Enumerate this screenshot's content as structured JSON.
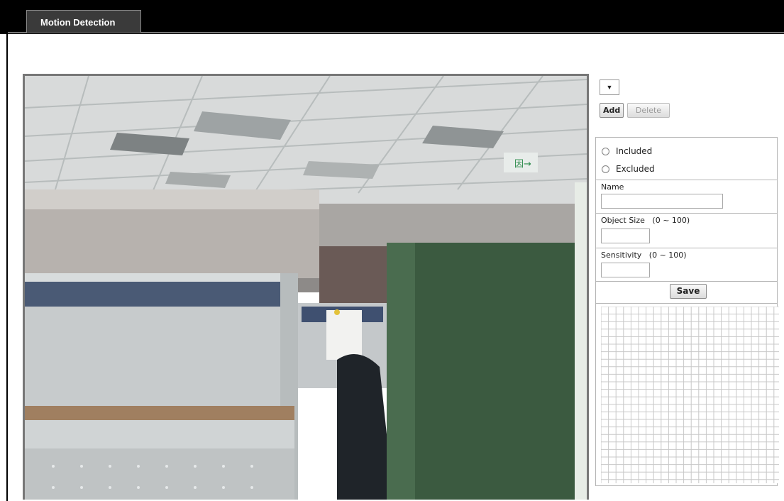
{
  "tabs": [
    {
      "label": "Motion Detection",
      "active": true
    }
  ],
  "camera": {
    "icon": "camera-feed-image"
  },
  "region_selector": {
    "value": "",
    "icon": "chevron-down-icon"
  },
  "buttons": {
    "add_label": "Add",
    "delete_label": "Delete",
    "delete_enabled": false,
    "save_label": "Save"
  },
  "mode": {
    "options": [
      {
        "label": "Included",
        "selected": false
      },
      {
        "label": "Excluded",
        "selected": false
      }
    ]
  },
  "fields": {
    "name": {
      "label": "Name",
      "value": ""
    },
    "object_size": {
      "label": "Object Size",
      "range": "(0 ~ 100)",
      "value": ""
    },
    "sensitivity": {
      "label": "Sensitivity",
      "range": "(0 ~ 100)",
      "value": ""
    }
  },
  "grid": {
    "icon": "detection-grid"
  },
  "colors": {
    "topbar": "#000000",
    "tab": "#3a3a3a",
    "panel_border": "#b5b5b5",
    "grid_line": "#c8c8c8"
  }
}
